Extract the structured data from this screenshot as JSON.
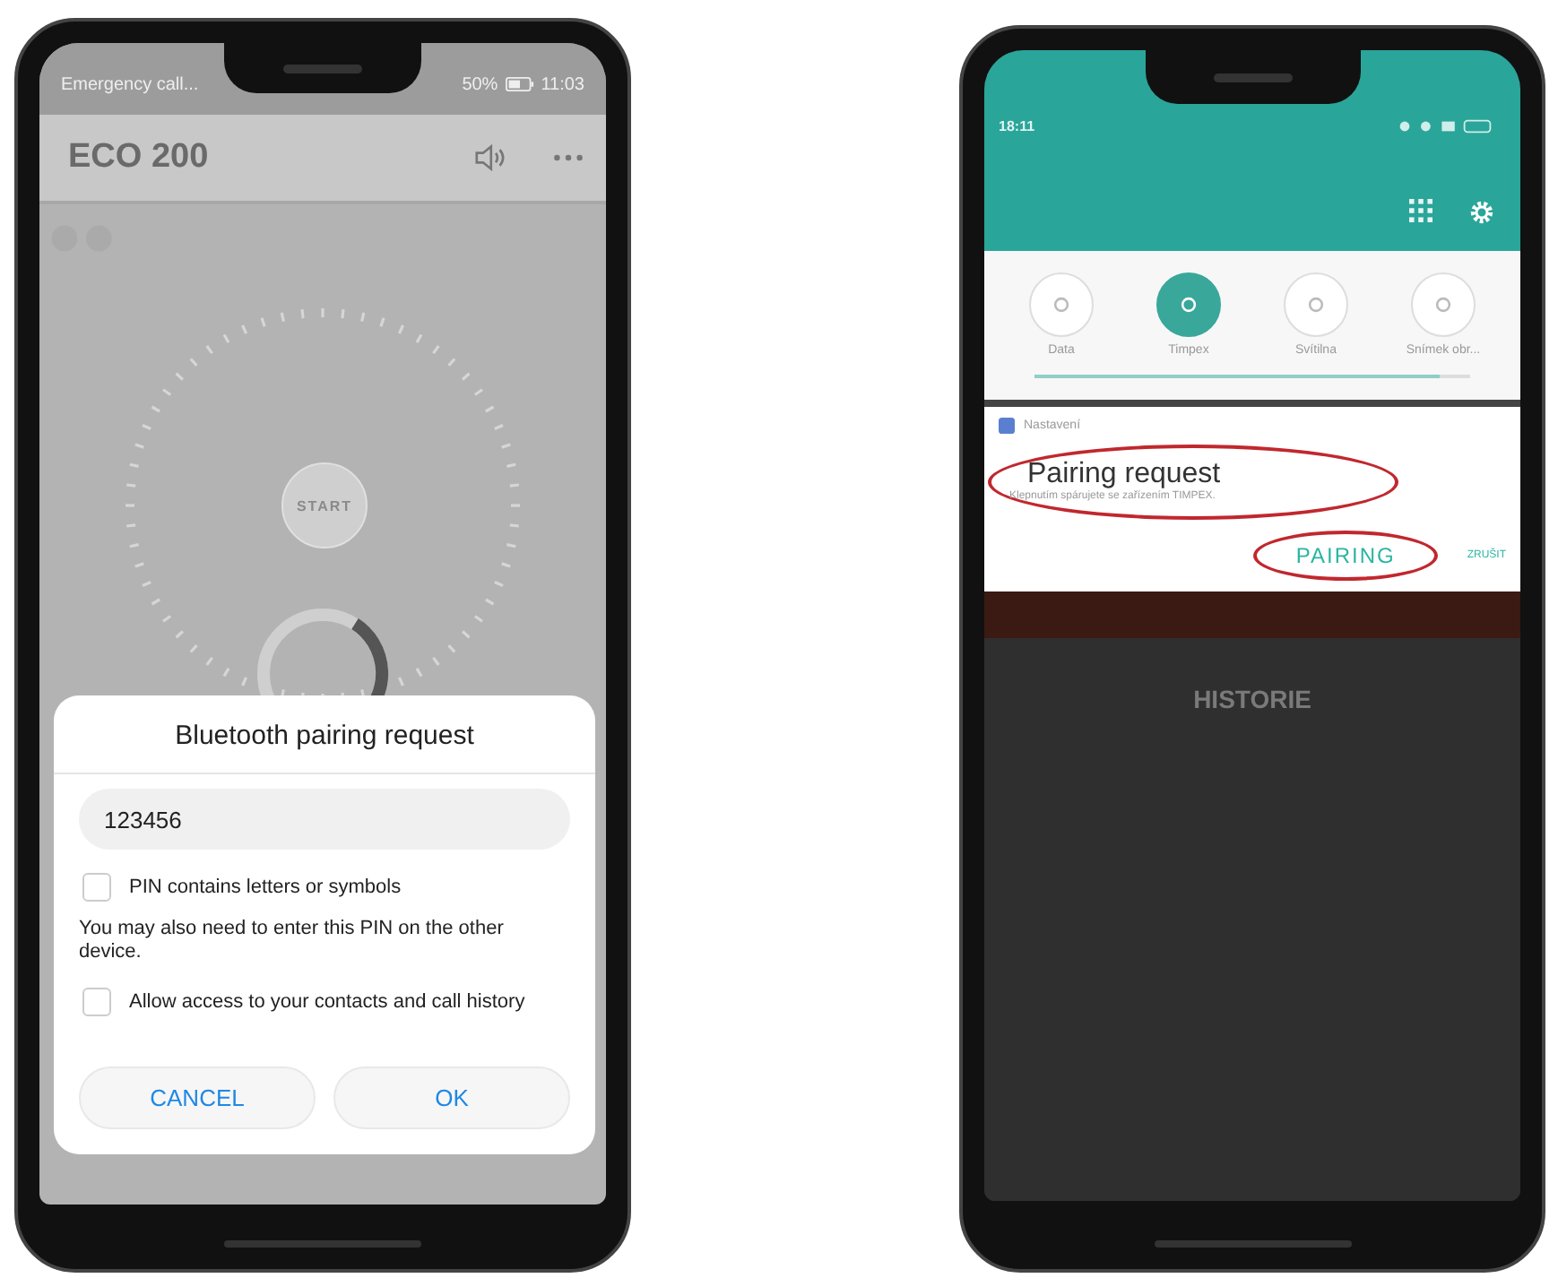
{
  "left_phone": {
    "status_bar": {
      "carrier": "Emergency call...",
      "battery": "50%",
      "time": "11:03"
    },
    "app_bar": {
      "title": "ECO 200"
    },
    "dial": {
      "button": "START"
    },
    "dialog": {
      "title": "Bluetooth pairing request",
      "pin": "123456",
      "options": [
        {
          "label": "PIN contains letters or symbols",
          "checked": false
        }
      ],
      "note": "You may also need to enter this PIN on the other device.",
      "access": {
        "label": "Allow access to your contacts and call history",
        "checked": false
      },
      "buttons": [
        {
          "label": "CANCEL"
        },
        {
          "label": "OK"
        }
      ]
    }
  },
  "right_phone": {
    "status_bar": {
      "time": "18:11"
    },
    "quick_tiles": [
      {
        "label": "Data",
        "selected": false
      },
      {
        "label": "Timpex",
        "selected": true
      },
      {
        "label": "Svítilna",
        "selected": false
      },
      {
        "label": "Snímek obr...",
        "selected": false
      }
    ],
    "brightness": {
      "level": 0.93
    },
    "notification": {
      "app": "Nastavení",
      "title": "Pairing request",
      "text": "Klepnutím spárujete se zařízením TIMPEX.",
      "actions": [
        {
          "label": "PAIRING",
          "kind": "primary"
        },
        {
          "label": "ZRUŠIT",
          "kind": "secondary"
        }
      ]
    },
    "background_app": {
      "heading": "HISTORIE"
    }
  }
}
